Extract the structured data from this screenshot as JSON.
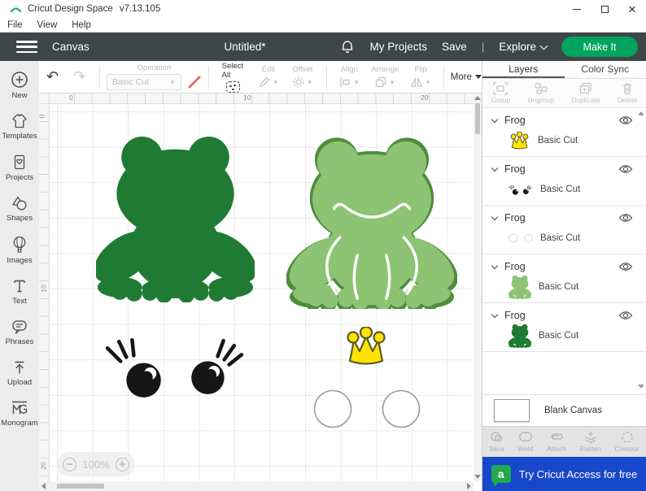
{
  "window": {
    "title": "Cricut Design Space",
    "version": "v7.13.105"
  },
  "menu": {
    "items": [
      "File",
      "View",
      "Help"
    ]
  },
  "header": {
    "canvas_label": "Canvas",
    "doc_title": "Untitled*",
    "my_projects": "My Projects",
    "save": "Save",
    "divider": "|",
    "explore": "Explore",
    "make_it": "Make It"
  },
  "toolbar": {
    "undo": "↶",
    "redo": "↷",
    "operation_label": "Operation",
    "operation_value": "Basic Cut",
    "select_all": "Select All",
    "edit": "Edit",
    "offset": "Offset",
    "align": "Align",
    "arrange": "Arrange",
    "flip": "Flip",
    "more": "More"
  },
  "sidebar": {
    "items": [
      {
        "label": "New",
        "icon": "plus-circle-icon"
      },
      {
        "label": "Templates",
        "icon": "shirt-icon"
      },
      {
        "label": "Projects",
        "icon": "project-card-icon"
      },
      {
        "label": "Shapes",
        "icon": "shapes-icon"
      },
      {
        "label": "Images",
        "icon": "balloon-icon"
      },
      {
        "label": "Text",
        "icon": "letter-t-icon"
      },
      {
        "label": "Phrases",
        "icon": "speech-bubble-icon"
      },
      {
        "label": "Upload",
        "icon": "upload-arrow-icon"
      },
      {
        "label": "Monogram",
        "icon": "monogram-icon"
      }
    ]
  },
  "canvas": {
    "ruler_top": [
      "0",
      "10",
      "20"
    ],
    "ruler_left": [
      "0",
      "10",
      "20"
    ],
    "zoom": "100%",
    "objects": [
      {
        "name": "frog-solid-silhouette",
        "color": "#1f7b34"
      },
      {
        "name": "frog-outlined",
        "color": "#8cc473"
      },
      {
        "name": "eyes-with-lashes",
        "color": "#161616"
      },
      {
        "name": "crown",
        "color": "#fce303"
      },
      {
        "name": "feet-circles",
        "color": "#ffffff"
      }
    ]
  },
  "layers": {
    "tabs": [
      "Layers",
      "Color Sync"
    ],
    "actions": [
      "Group",
      "Ungroup",
      "Duplicate",
      "Delete"
    ],
    "items": [
      {
        "name": "Frog",
        "cut": "Basic Cut",
        "thumb": "crown"
      },
      {
        "name": "Frog",
        "cut": "Basic Cut",
        "thumb": "eyes"
      },
      {
        "name": "Frog",
        "cut": "Basic Cut",
        "thumb": "circles"
      },
      {
        "name": "Frog",
        "cut": "Basic Cut",
        "thumb": "frog-light"
      },
      {
        "name": "Frog",
        "cut": "Basic Cut",
        "thumb": "frog-dark"
      }
    ],
    "blank_canvas": "Blank Canvas",
    "tools": [
      "Slice",
      "Weld",
      "Attach",
      "Flatten",
      "Contour"
    ],
    "banner_text": "Try Cricut Access for free",
    "banner_icon_letter": "a"
  },
  "colors": {
    "header_bg": "#3e4649",
    "make_it_green": "#00a45e",
    "banner_blue": "#1747cb",
    "access_green": "#21a94d",
    "frog_dark": "#1f7b34",
    "frog_light": "#8cc473",
    "crown_yellow": "#fce303"
  }
}
